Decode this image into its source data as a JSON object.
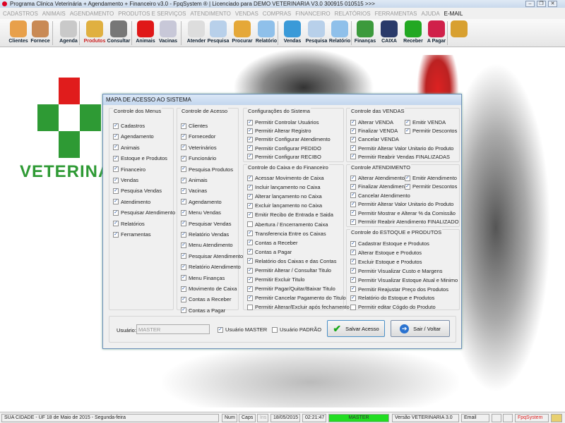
{
  "window": {
    "title": "Programa Clinica Veterinária + Agendamento + Financeiro v3.0 - FpqSystem ® | Licenciado para  DEMO VETERINARIA V3.0 300915 010515 >>>",
    "min": "–",
    "max": "❐",
    "close": "✕"
  },
  "menu": [
    "CADASTROS",
    "ANIMAIS",
    "AGENDAMENTO",
    "PRODUTOS E SERVIÇOS",
    "ATENDIMENTO",
    "VENDAS",
    "COMPRAS",
    "FINANCEIRO",
    "RELATÓRIOS",
    "FERRAMENTAS",
    "AJUDA",
    "E-MAIL"
  ],
  "toolbar": [
    {
      "label": "Clientes",
      "icon": "clients-icon",
      "color": "#e8a04a"
    },
    {
      "label": "Fornece",
      "icon": "supplier-icon",
      "color": "#c98a55"
    },
    {
      "label": "Agenda",
      "icon": "calendar-icon",
      "color": "#c9c9c9"
    },
    {
      "label": "Produtos",
      "icon": "boxes-icon",
      "color": "#e0b040"
    },
    {
      "label": "Consultar",
      "icon": "barcode-icon",
      "color": "#777777"
    },
    {
      "label": "Animais",
      "icon": "paw-icon",
      "color": "#e01818"
    },
    {
      "label": "Vacinas",
      "icon": "syringe-icon",
      "color": "#c8c8d8"
    },
    {
      "label": "Atender",
      "icon": "paw-plus-icon",
      "color": "#dddddd"
    },
    {
      "label": "Pesquisa",
      "icon": "search-doc-icon",
      "color": "#b8d0ea"
    },
    {
      "label": "Procurar",
      "icon": "folder-icon",
      "color": "#e5a838"
    },
    {
      "label": "Relatório",
      "icon": "report-icon",
      "color": "#8fc0ea"
    },
    {
      "label": "Vendas",
      "icon": "monitor-icon",
      "color": "#3a9ad8"
    },
    {
      "label": "Pesquisa",
      "icon": "search-doc-icon",
      "color": "#b8d0ea"
    },
    {
      "label": "Relatório",
      "icon": "report-icon",
      "color": "#8fc0ea"
    },
    {
      "label": "Finanças",
      "icon": "finance-chart-icon",
      "color": "#3c9a3c"
    },
    {
      "label": "CAIXA",
      "icon": "cash-book-icon",
      "color": "#2a3a6a"
    },
    {
      "label": "Receber",
      "icon": "dollar-green-icon",
      "color": "#22a822"
    },
    {
      "label": "A Pagar",
      "icon": "dollar-red-icon",
      "color": "#d0204a"
    },
    {
      "label": "",
      "icon": "exit-door-icon",
      "color": "#d8a030"
    }
  ],
  "background": {
    "logo_text": "VETERINÁRIA"
  },
  "dialog": {
    "title": "MAPA DE ACESSO AO SISTEMA",
    "groups": [
      {
        "title": "Controle dos Menus",
        "items": [
          {
            "l": "Cadastros",
            "c": true
          },
          {
            "l": "Agendamento",
            "c": true
          },
          {
            "l": "Animais",
            "c": true
          },
          {
            "l": "Estoque e Produtos",
            "c": true
          },
          {
            "l": "Financeiro",
            "c": true
          },
          {
            "l": "Vendas",
            "c": true
          },
          {
            "l": "Pesquisa Vendas",
            "c": true
          },
          {
            "l": "Atendimento",
            "c": true
          },
          {
            "l": "Pesquisar Atendimento",
            "c": true
          },
          {
            "l": "Relatórios",
            "c": true
          },
          {
            "l": "Ferramentas",
            "c": true
          }
        ]
      },
      {
        "title": "Controle de Acesso",
        "items": [
          {
            "l": "Clientes",
            "c": true
          },
          {
            "l": "Fornecedor",
            "c": true
          },
          {
            "l": "Veterinários",
            "c": true
          },
          {
            "l": "Funcionário",
            "c": true
          },
          {
            "l": "Pesquisa Produtos",
            "c": true
          },
          {
            "l": "Animais",
            "c": true
          },
          {
            "l": "Vacinas",
            "c": true
          },
          {
            "l": "Agendamento",
            "c": true
          },
          {
            "l": "Menu Vendas",
            "c": true
          },
          {
            "l": "Pesquisar Vendas",
            "c": true
          },
          {
            "l": "Relatório Vendas",
            "c": true
          },
          {
            "l": "Menu Atendimento",
            "c": true
          },
          {
            "l": "Pesquisar Atendimento",
            "c": true
          },
          {
            "l": "Relatório Atendimento",
            "c": true
          },
          {
            "l": "Menu Finanças",
            "c": true
          },
          {
            "l": "Movimento de Caixa",
            "c": true
          },
          {
            "l": "Contas a Receber",
            "c": true
          },
          {
            "l": "Contas a Pagar",
            "c": true
          }
        ]
      },
      {
        "title": "Configurações do Sistema",
        "items": [
          {
            "l": "Permitir Controlar Usuários",
            "c": true
          },
          {
            "l": "Permitir Alterar Registro",
            "c": true
          },
          {
            "l": "Permitir Configurar Atendimento",
            "c": true
          },
          {
            "l": "Permitir Configurar PEDIDO",
            "c": true
          },
          {
            "l": "Permitir Configurar RECIBO",
            "c": true
          }
        ]
      },
      {
        "title": "Controle do Caixa e do Financeiro",
        "items": [
          {
            "l": "Acessar Movimento de Caixa",
            "c": true
          },
          {
            "l": "Incluir lançamento no Caixa",
            "c": true
          },
          {
            "l": "Alterar lançamento no Caixa",
            "c": true
          },
          {
            "l": "Excluir lançamento no Caixa",
            "c": true
          },
          {
            "l": "Emitir Recibo de Entrada e Saida",
            "c": true
          },
          {
            "l": "Abertura / Encerramento Caixa",
            "c": false
          },
          {
            "l": "Transferencia Entre os Caixas",
            "c": true
          },
          {
            "l": "Contas a Receber",
            "c": true
          },
          {
            "l": "Contas a Pagar",
            "c": true
          },
          {
            "l": "Relatório dos Caixas e das Contas",
            "c": true
          },
          {
            "l": "Permitir Alterar / Consultar Titulo",
            "c": true
          },
          {
            "l": "Permitir Excluir Titulo",
            "c": true
          },
          {
            "l": "Permitir Pagar/Quitar/Baixar Titulo",
            "c": true
          },
          {
            "l": "Permitir Cancelar Pagamento do Titulo",
            "c": true
          },
          {
            "l": "Permitir Alterar/Excluir após fechamento",
            "c": false
          }
        ]
      },
      {
        "title": "Controle das VENDAS",
        "items": [
          {
            "l": "Alterar VENDA",
            "c": true
          },
          {
            "l": "Emitir VENDA",
            "c": true
          },
          {
            "l": "Finalizar VENDA",
            "c": true
          },
          {
            "l": "Permitir Descontos",
            "c": true
          },
          {
            "l": "Cancelar VENDA",
            "c": true
          },
          {
            "l": "Permitir Alterar Valor Unitario do Produto",
            "c": true
          },
          {
            "l": "Permitir Reabrir Vendas FINALIZADAS",
            "c": true
          }
        ]
      },
      {
        "title": "Controle ATENDIMENTO",
        "items": [
          {
            "l": "Alterar Atendimento",
            "c": true
          },
          {
            "l": "Emitir Atendimento",
            "c": true
          },
          {
            "l": "Finalizar Atendimento",
            "c": true
          },
          {
            "l": "Permitir Descontos",
            "c": true
          },
          {
            "l": "Cancelar Atendimento",
            "c": true
          },
          {
            "l": "Permitir Alterar Valor Unitario do Produto",
            "c": true
          },
          {
            "l": "Permitir Mostrar e Alterar % da Comissão",
            "c": true
          },
          {
            "l": "Permitir Reabrir Atendimento FINALIZADO",
            "c": true
          }
        ]
      },
      {
        "title": "Controle do ESTOQUE e PRODUTOS",
        "items": [
          {
            "l": "Cadastrar Estoque e Produtos",
            "c": true
          },
          {
            "l": "Alterar Estoque e Produtos",
            "c": true
          },
          {
            "l": "Excluir Estoque e Produtos",
            "c": true
          },
          {
            "l": "Permitir Visualizar Custo e Margens",
            "c": true
          },
          {
            "l": "Permitir Visualizar Estoque Atual e Minimo",
            "c": true
          },
          {
            "l": "Permitir Reajustar Preço dos Produtos",
            "c": true
          },
          {
            "l": "Relatório do Estoque e Produtos",
            "c": true
          },
          {
            "l": "Permitir editar Cógdo do Produto",
            "c": false
          }
        ]
      }
    ],
    "user_label": "Usuário:",
    "user_value": "MASTER",
    "master": {
      "l": "Usuário MASTER",
      "c": true
    },
    "padrao": {
      "l": "Usuário PADRÃO",
      "c": false
    },
    "save": "Salvar Acesso",
    "exit": "Sair / Voltar"
  },
  "status": {
    "city": "SUA CIDADE - UF 18 de Maio de 2015 - Segunda-feira",
    "num": "Num",
    "caps": "Caps",
    "ins": "Ins",
    "date": "18/05/2015",
    "time": "02:21:47",
    "user": "MASTER",
    "version": "Versão VETERINARIA 3.0",
    "email": "Email",
    "brand": "FpqSystem",
    "user_color": "#22dd22"
  }
}
